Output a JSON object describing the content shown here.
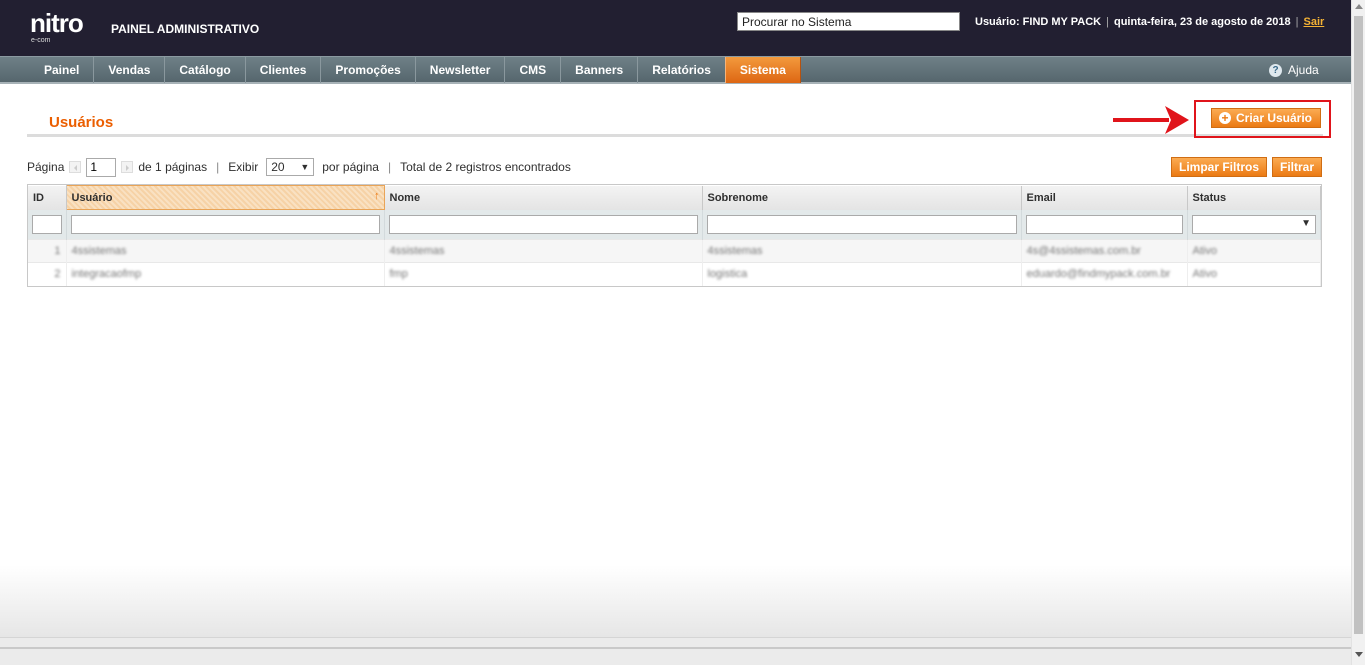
{
  "header": {
    "logo_text": "nitro",
    "logo_sub": "e-com",
    "panel_title": "PAINEL ADMINISTRATIVO",
    "search_value": "Procurar no Sistema",
    "user_label": "Usuário: FIND MY PACK",
    "date": "quinta-feira, 23 de agosto de 2018",
    "logout": "Sair",
    "bg_color": "#221f31"
  },
  "nav": {
    "items": [
      "Painel",
      "Vendas",
      "Catálogo",
      "Clientes",
      "Promoções",
      "Newsletter",
      "CMS",
      "Banners",
      "Relatórios",
      "Sistema"
    ],
    "active": "Sistema",
    "help_label": "Ajuda"
  },
  "page": {
    "title": "Usuários",
    "create_button": "Criar Usuário",
    "clear_filters_button": "Limpar Filtros",
    "filter_button": "Filtrar",
    "accent_color": "#eb7a14"
  },
  "pager": {
    "page_label": "Página",
    "page_value": "1",
    "of_pages": "de 1 páginas",
    "show_label": "Exibir",
    "per_page_value": "20",
    "per_page_label": "por página",
    "total": "Total de 2 registros encontrados"
  },
  "grid": {
    "columns": [
      "ID",
      "Usuário",
      "Nome",
      "Sobrenome",
      "Email",
      "Status"
    ],
    "sorted_column": "Usuário",
    "rows": [
      [
        "1",
        "4ssistemas",
        "4ssistemas",
        "4ssistemas",
        "4s@4ssistemas.com.br",
        "Ativo"
      ],
      [
        "2",
        "integracaofmp",
        "fmp",
        "logistica",
        "eduardo@findmypack.com.br",
        "Ativo"
      ]
    ]
  }
}
